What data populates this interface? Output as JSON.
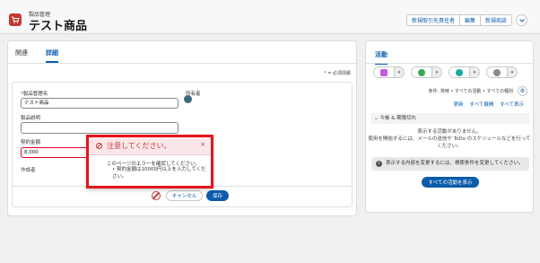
{
  "header": {
    "object_label": "製品管理",
    "record_title": "テスト商品",
    "buttons": [
      "新規取引先責任者",
      "編集",
      "新規商談"
    ]
  },
  "tabs": [
    "関連",
    "詳細"
  ],
  "form": {
    "required_info": "= 必須情報",
    "required_marker": "*",
    "product_name_label": "製品管理名",
    "product_name_value": "テスト商品",
    "owner_label": "所有者",
    "description_label": "製品説明",
    "description_value": "",
    "contract_amount_label": "契約金額",
    "contract_amount_value": "8,000",
    "created_by_label": "作成者",
    "cancel_label": "キャンセル",
    "save_label": "保存"
  },
  "error_popover": {
    "title": "注意してください。",
    "close": "×",
    "body": "このページのエラーを確認してください。",
    "message": "• 契約金額は10000円以上を入力してください。"
  },
  "activity": {
    "tab": "活動",
    "filter_text": "条件: 常時 • すべての活動 • すべての種別",
    "links": [
      "更新",
      "すべて展開",
      "すべて表示"
    ],
    "upcoming_label": "今後 & 期限切れ",
    "no_activity": "表示する活動がありません。",
    "no_activity_hint": "使用を開始するには、メールの送信や ToDo のスケジュールなどを行ってください。",
    "notice": "表示する内容を変更するには、検索条件を変更してください。",
    "show_all": "すべての活動を表示",
    "colors": {
      "log": "#c55ae0",
      "event": "#3ba755",
      "task": "#1aa9a2",
      "email": "#8a8a8a"
    }
  },
  "colors": {
    "brand": "#0b5cab",
    "error": "#ea001e",
    "object_icon": "#c23934"
  }
}
